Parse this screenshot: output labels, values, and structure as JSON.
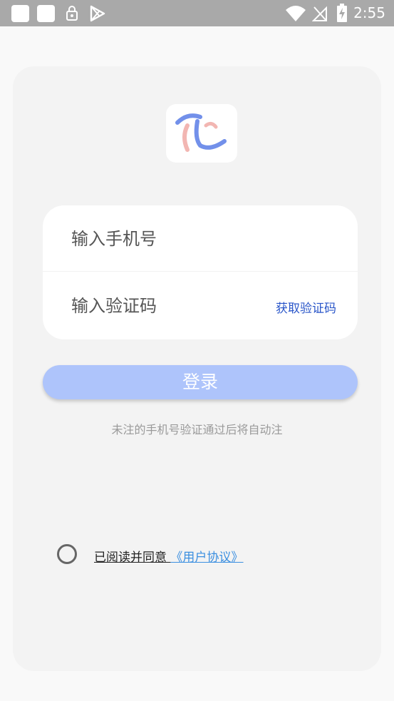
{
  "status_bar": {
    "time": "2:55",
    "icons": [
      "square-notification-icon",
      "square-notification-icon",
      "lock-icon",
      "play-store-icon",
      "wifi-icon",
      "no-signal-icon",
      "battery-charging-icon"
    ]
  },
  "logo": {
    "icon": "app-logo-icon"
  },
  "form": {
    "phone_placeholder": "输入手机号",
    "code_placeholder": "输入验证码",
    "get_code_label": "获取验证码"
  },
  "login": {
    "button_label": "登录",
    "hint": "未注的手机号验证通过后将自动注"
  },
  "agreement": {
    "prefix": "已阅读并同意",
    "link": "《用户协议》"
  },
  "colors": {
    "status_bar": "#a9a9a9",
    "button": "#aec4fb",
    "link": "#3b8fe0",
    "get_code": "#2a56c9"
  }
}
